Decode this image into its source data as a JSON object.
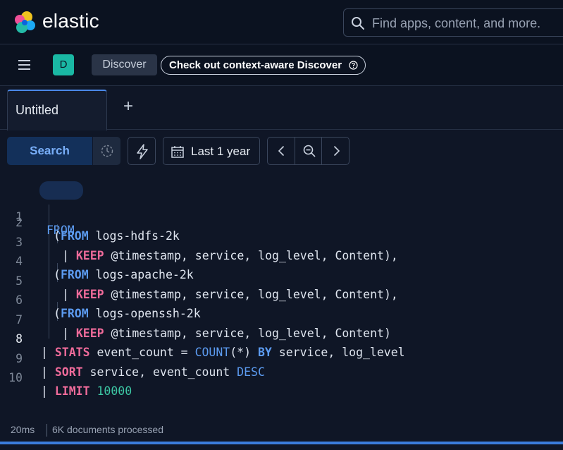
{
  "header": {
    "brand": "elastic",
    "search_placeholder": "Find apps, content, and more."
  },
  "nav": {
    "space_initial": "D",
    "breadcrumb": "Discover",
    "promo": "Check out context-aware Discover"
  },
  "tabs": [
    {
      "label": "Untitled"
    }
  ],
  "toolbar": {
    "search_label": "Search",
    "date_label": "Last 1 year"
  },
  "editor": {
    "line_numbers": [
      "1",
      "2",
      "3",
      "4",
      "5",
      "6",
      "7",
      "8",
      "9",
      "10"
    ],
    "lines": [
      "FROM",
      "(FROM logs-hdfs-2k",
      "| KEEP @timestamp, service, log_level, Content),",
      "(FROM logs-apache-2k",
      "| KEEP @timestamp, service, log_level, Content),",
      "(FROM logs-openssh-2k",
      "| KEEP @timestamp, service, log_level, Content)",
      "| STATS event_count = COUNT(*) BY service, log_level",
      "| SORT service, event_count DESC",
      "| LIMIT 10000"
    ]
  },
  "status": {
    "time": "20ms",
    "docs": "6K documents processed"
  },
  "colors": {
    "accent": "#3b7ddd",
    "keyword_blue": "#5c9bf0",
    "keyword_red": "#ef6b9a",
    "number": "#3dc8a5"
  }
}
